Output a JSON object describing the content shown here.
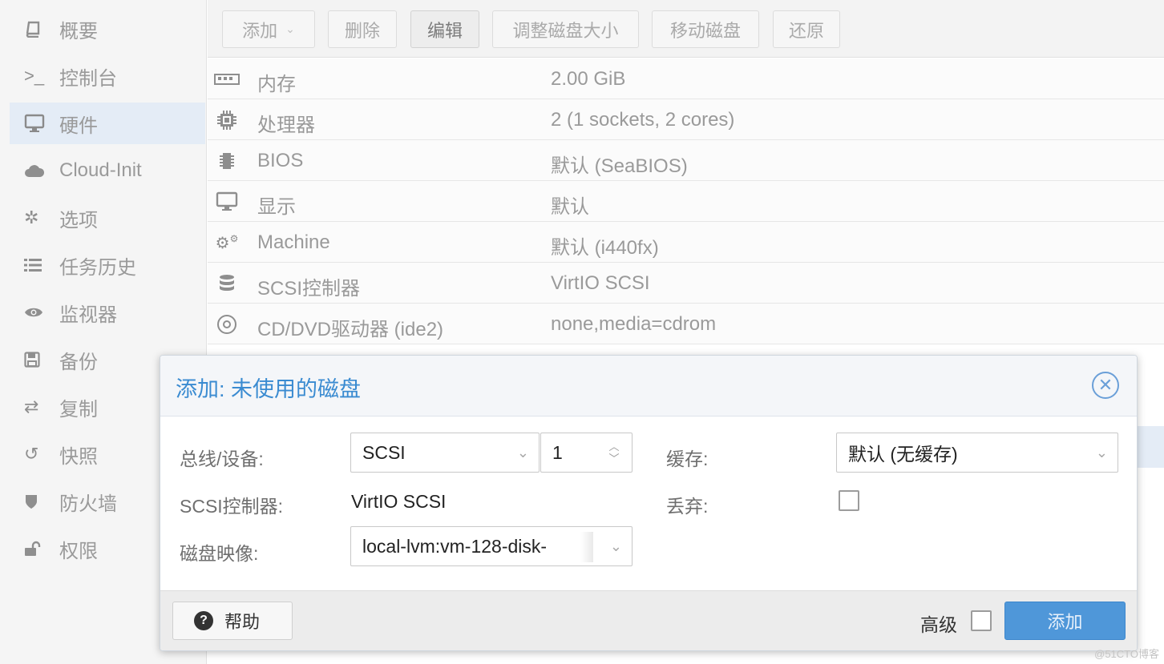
{
  "sidebar": {
    "items": [
      {
        "label": "概要",
        "icon": "book-icon"
      },
      {
        "label": "控制台",
        "icon": "terminal-icon"
      },
      {
        "label": "硬件",
        "icon": "desktop-icon",
        "active": true
      },
      {
        "label": "Cloud-Init",
        "icon": "cloud-icon"
      },
      {
        "label": "选项",
        "icon": "gear-icon"
      },
      {
        "label": "任务历史",
        "icon": "list-icon"
      },
      {
        "label": "监视器",
        "icon": "eye-icon"
      },
      {
        "label": "备份",
        "icon": "floppy-icon"
      },
      {
        "label": "复制",
        "icon": "retweet-icon"
      },
      {
        "label": "快照",
        "icon": "history-icon"
      },
      {
        "label": "防火墙",
        "icon": "shield-icon"
      },
      {
        "label": "权限",
        "icon": "unlock-icon"
      }
    ]
  },
  "toolbar": {
    "add": "添加",
    "remove": "删除",
    "edit": "编辑",
    "resize": "调整磁盘大小",
    "move": "移动磁盘",
    "revert": "还原"
  },
  "hardware": [
    {
      "name": "内存",
      "value": "2.00 GiB",
      "icon": "memory-icon"
    },
    {
      "name": "处理器",
      "value": "2 (1 sockets, 2 cores)",
      "icon": "cpu-icon"
    },
    {
      "name": "BIOS",
      "value": "默认 (SeaBIOS)",
      "icon": "microchip-icon"
    },
    {
      "name": "显示",
      "value": "默认",
      "icon": "desktop-icon"
    },
    {
      "name": "Machine",
      "value": "默认 (i440fx)",
      "icon": "cogs-icon"
    },
    {
      "name": "SCSI控制器",
      "value": "VirtIO SCSI",
      "icon": "database-icon"
    },
    {
      "name": "CD/DVD驱动器 (ide2)",
      "value": "none,media=cdrom",
      "icon": "cdrom-icon"
    }
  ],
  "dialog": {
    "title": "添加: 未使用的磁盘",
    "bus_label": "总线/设备:",
    "bus_value": "SCSI",
    "device_value": "1",
    "controller_label": "SCSI控制器:",
    "controller_value": "VirtIO SCSI",
    "image_label": "磁盘映像:",
    "image_value": "local-lvm:vm-128-disk-",
    "cache_label": "缓存:",
    "cache_value": "默认 (无缓存)",
    "discard_label": "丢弃:",
    "discard_checked": false,
    "help": "帮助",
    "advanced": "高级",
    "advanced_checked": false,
    "submit": "添加"
  },
  "watermark": "@51CTO博客",
  "colors": {
    "accent": "#3a8bd1",
    "primary_button": "#4f97d9",
    "selected_row": "#e4ecf6"
  }
}
